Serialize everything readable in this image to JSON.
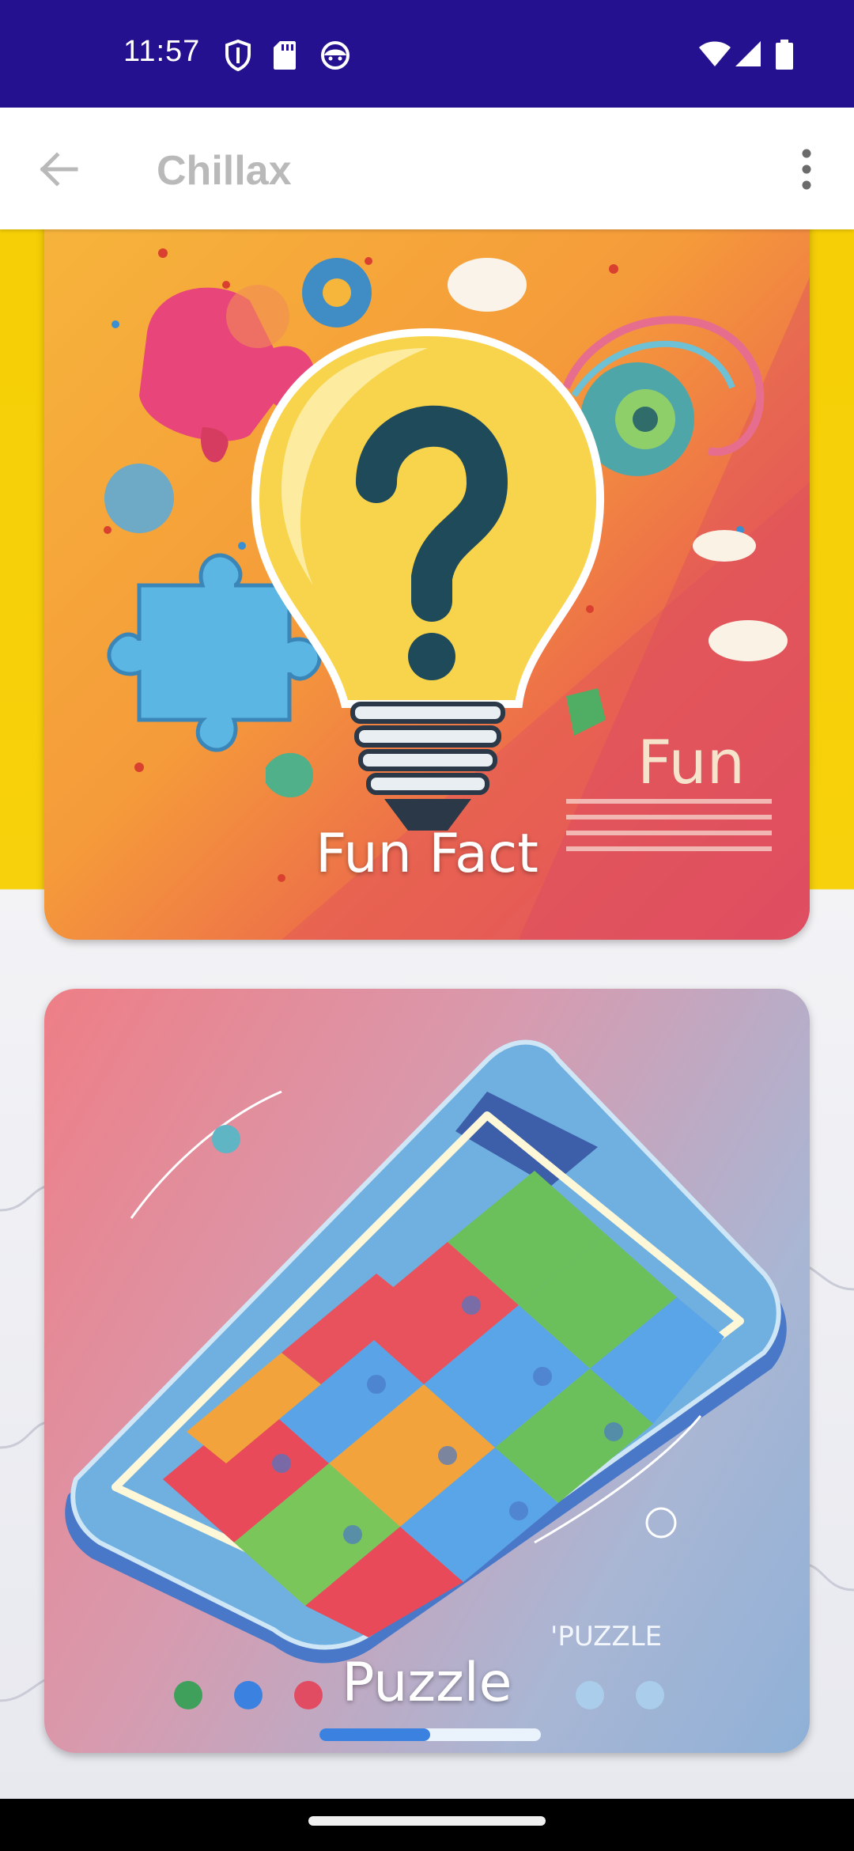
{
  "status_bar": {
    "time": "11:57",
    "background": "#24118f",
    "left_icons": [
      "shield-icon",
      "sd-card-icon",
      "android-face-icon"
    ],
    "right_icons": [
      "wifi-icon",
      "cell-signal-icon",
      "battery-icon"
    ]
  },
  "app_bar": {
    "title": "Chillax",
    "back_icon": "arrow-left-icon",
    "menu_icon": "more-vertical-icon"
  },
  "cards": [
    {
      "label": "Fun Fact",
      "image_text": "Fun",
      "image": "lightbulb-question-illustration"
    },
    {
      "label": "Puzzle",
      "image_text": "'PUZZLE",
      "image": "puzzle-phone-illustration"
    }
  ],
  "colors": {
    "accent": "#24118f",
    "background_top": "#f6cf06",
    "title": "#b9b9b9"
  }
}
